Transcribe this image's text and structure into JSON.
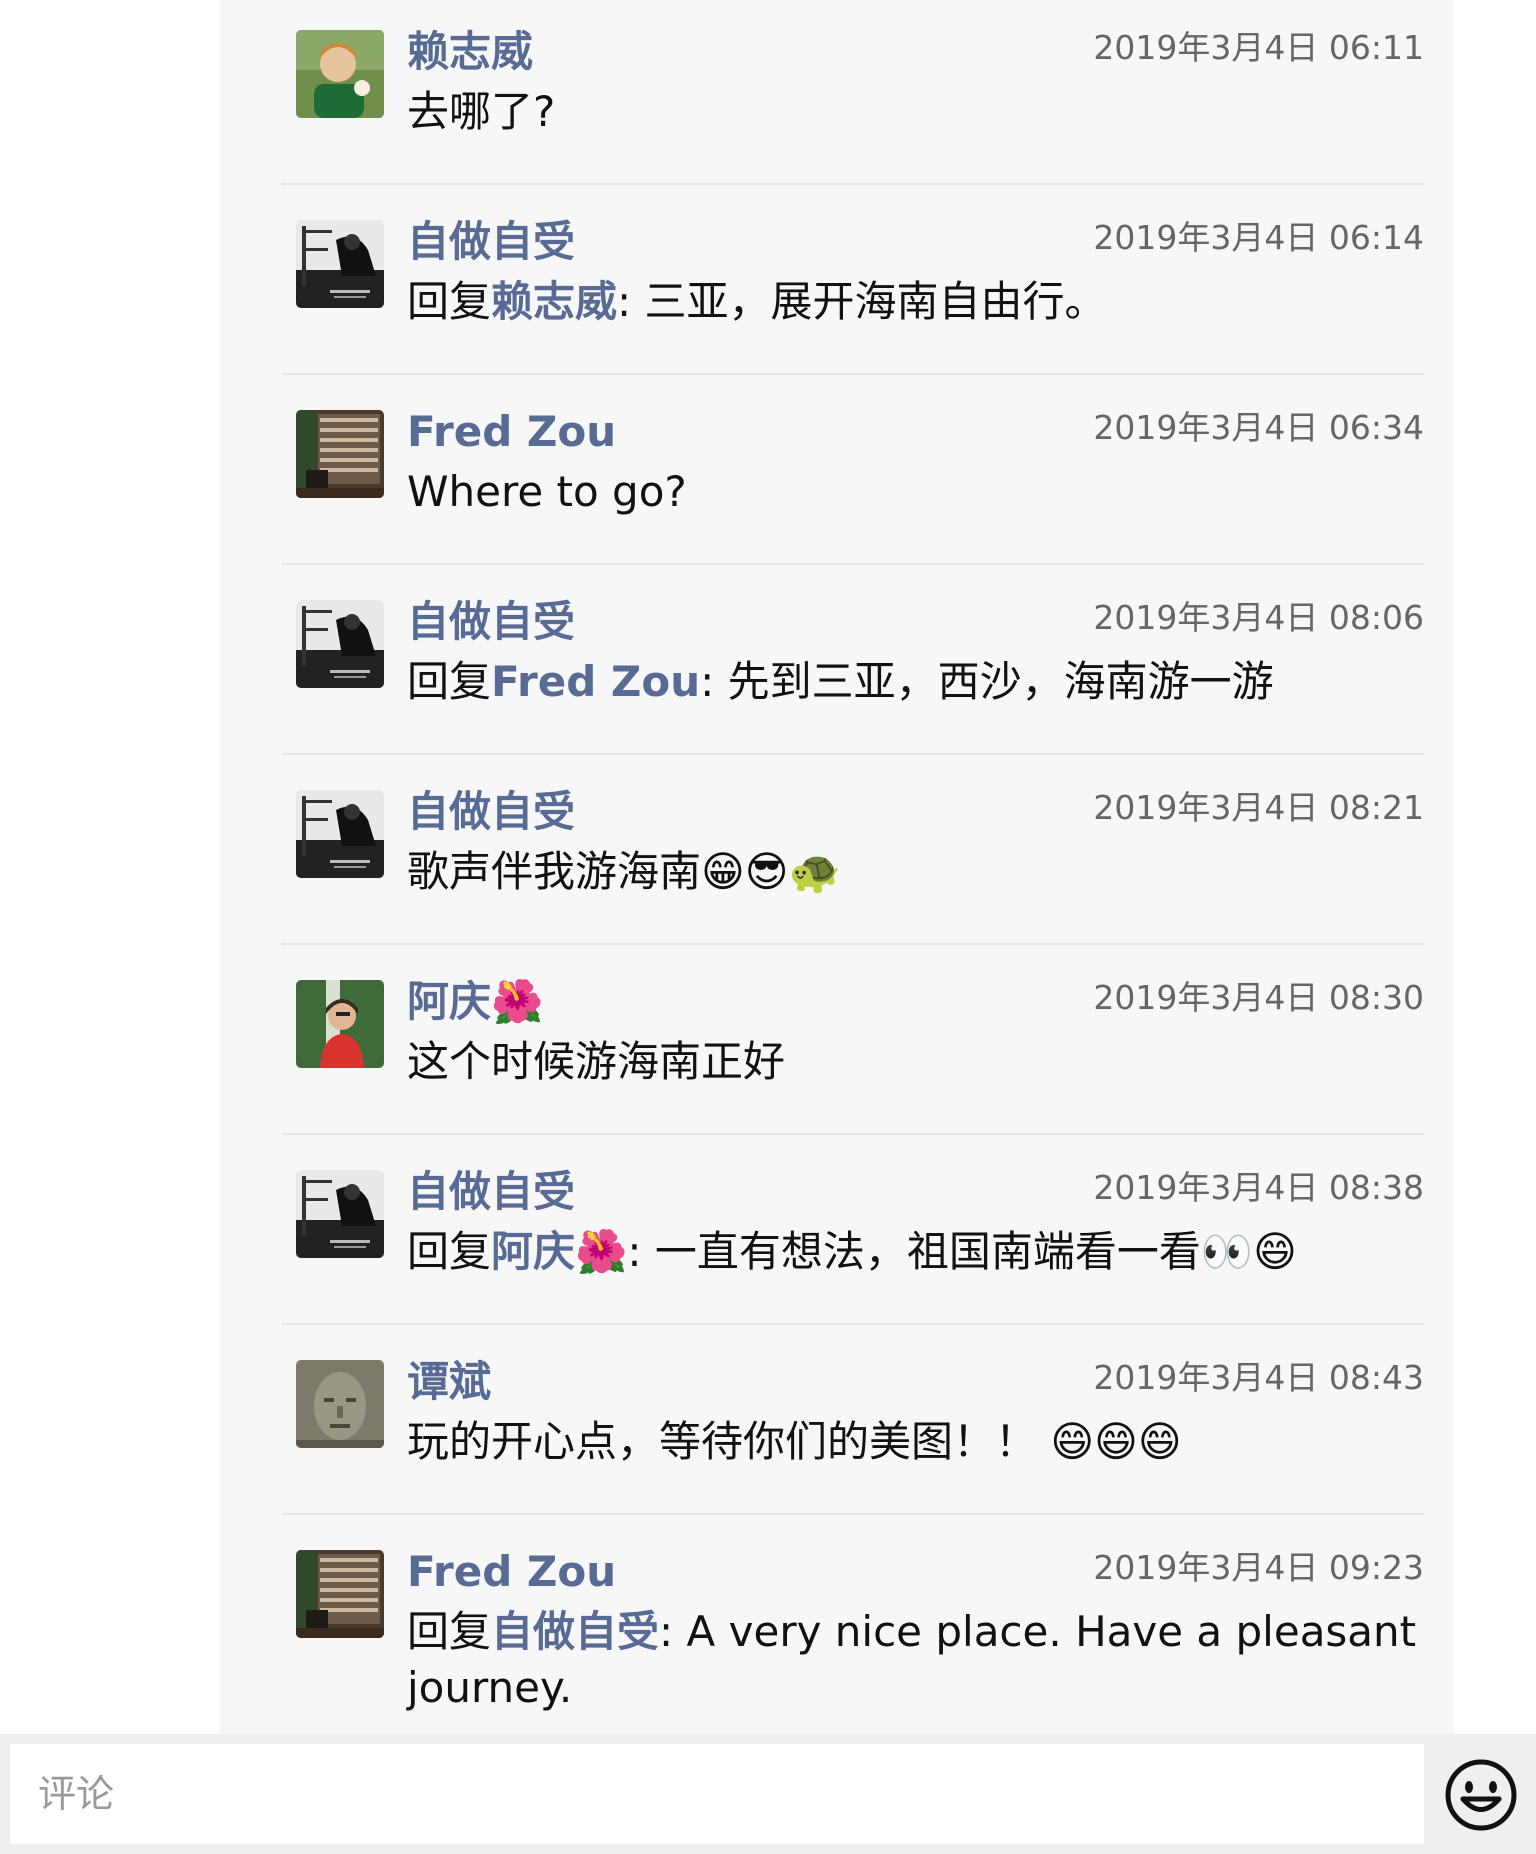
{
  "comments": [
    {
      "author": "赖志威",
      "time": "2019年3月4日 06:11",
      "text": "去哪了?",
      "reply_to": ""
    },
    {
      "author": "自做自受",
      "time": "2019年3月4日 06:14",
      "reply_prefix": "回复",
      "reply_to": "赖志威",
      "text": "三亚，展开海南自由行。"
    },
    {
      "author": "Fred Zou",
      "time": "2019年3月4日 06:34",
      "text": "Where to go?",
      "reply_to": ""
    },
    {
      "author": "自做自受",
      "time": "2019年3月4日 08:06",
      "reply_prefix": "回复",
      "reply_to": "Fred Zou",
      "text": "先到三亚，西沙，海南游一游"
    },
    {
      "author": "自做自受",
      "time": "2019年3月4日 08:21",
      "text": "歌声伴我游海南😁😎🐢",
      "reply_to": ""
    },
    {
      "author": "阿庆🌺",
      "time": "2019年3月4日 08:30",
      "text": "这个时候游海南正好",
      "reply_to": ""
    },
    {
      "author": "自做自受",
      "time": "2019年3月4日 08:38",
      "reply_prefix": "回复",
      "reply_to": "阿庆🌺",
      "text": "一直有想法，祖国南端看一看👀😄"
    },
    {
      "author": "谭斌",
      "time": "2019年3月4日 08:43",
      "text": "玩的开心点，等待你们的美图！！ 😄😄😄",
      "reply_to": ""
    },
    {
      "author": "Fred Zou",
      "time": "2019年3月4日 09:23",
      "reply_prefix": "回复",
      "reply_to": "自做自受",
      "text": "A very nice place. Have a pleasant journey."
    }
  ],
  "reply_separator": ": ",
  "composer": {
    "placeholder": "评论"
  },
  "icons": {
    "emoji_button": "smiley-face-icon"
  },
  "colors": {
    "author_link": "#576b95",
    "thread_background": "#f7f7f7",
    "divider": "#e5e5e5",
    "timestamp": "#666666"
  }
}
